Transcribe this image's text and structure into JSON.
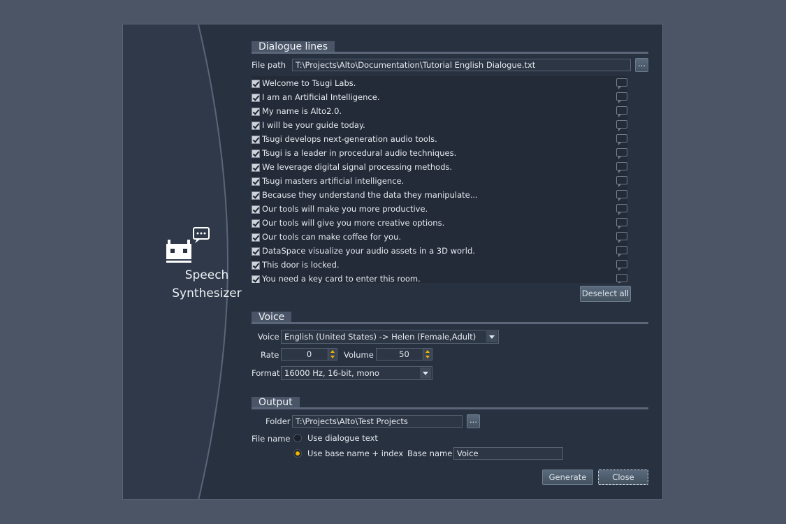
{
  "app": {
    "name_line1": "Speech",
    "name_line2": "Synthesizer"
  },
  "dialogue": {
    "section_title": "Dialogue lines",
    "file_path_label": "File path",
    "file_path": "T:\\Projects\\Alto\\Documentation\\Tutorial English Dialogue.txt",
    "browse_label": "...",
    "lines": [
      {
        "text": "Welcome to Tsugi Labs.",
        "checked": true
      },
      {
        "text": "I am an Artificial Intelligence.",
        "checked": true
      },
      {
        "text": "My name is Alto2.0.",
        "checked": true
      },
      {
        "text": "I will be your guide today.",
        "checked": true
      },
      {
        "text": "Tsugi develops next-generation audio tools.",
        "checked": true
      },
      {
        "text": "Tsugi is a leader in procedural audio techniques.",
        "checked": true
      },
      {
        "text": "We leverage digital signal processing methods.",
        "checked": true
      },
      {
        "text": "Tsugi masters artificial intelligence.",
        "checked": true
      },
      {
        "text": "Because they understand the data they manipulate...",
        "checked": true
      },
      {
        "text": "Our tools will make you more productive.",
        "checked": true
      },
      {
        "text": "Our tools will give you more creative options.",
        "checked": true
      },
      {
        "text": "Our tools can make coffee for you.",
        "checked": true
      },
      {
        "text": "DataSpace visualize your audio assets in a 3D world.",
        "checked": true
      },
      {
        "text": "This door is locked.",
        "checked": true
      },
      {
        "text": "You need a key card to enter this room.",
        "checked": true
      }
    ],
    "deselect_label": "Deselect all"
  },
  "voice": {
    "section_title": "Voice",
    "voice_label": "Voice",
    "voice_value": "English (United States)  ->  Helen (Female,Adult)",
    "rate_label": "Rate",
    "rate_value": "0",
    "volume_label": "Volume",
    "volume_value": "50",
    "format_label": "Format",
    "format_value": "16000 Hz, 16-bit, mono"
  },
  "output": {
    "section_title": "Output",
    "folder_label": "Folder",
    "folder_value": "T:\\Projects\\Alto\\Test Projects",
    "browse_label": "...",
    "filename_label": "File name",
    "option_dialogue": "Use dialogue text",
    "option_base": "Use base name + index",
    "selected_option": "base",
    "base_name_label": "Base name",
    "base_name_value": "Voice"
  },
  "footer": {
    "generate_label": "Generate",
    "close_label": "Close"
  },
  "colors": {
    "accent": "#f0b400",
    "dialog_bg": "#283140",
    "page_bg": "#4b5566"
  }
}
